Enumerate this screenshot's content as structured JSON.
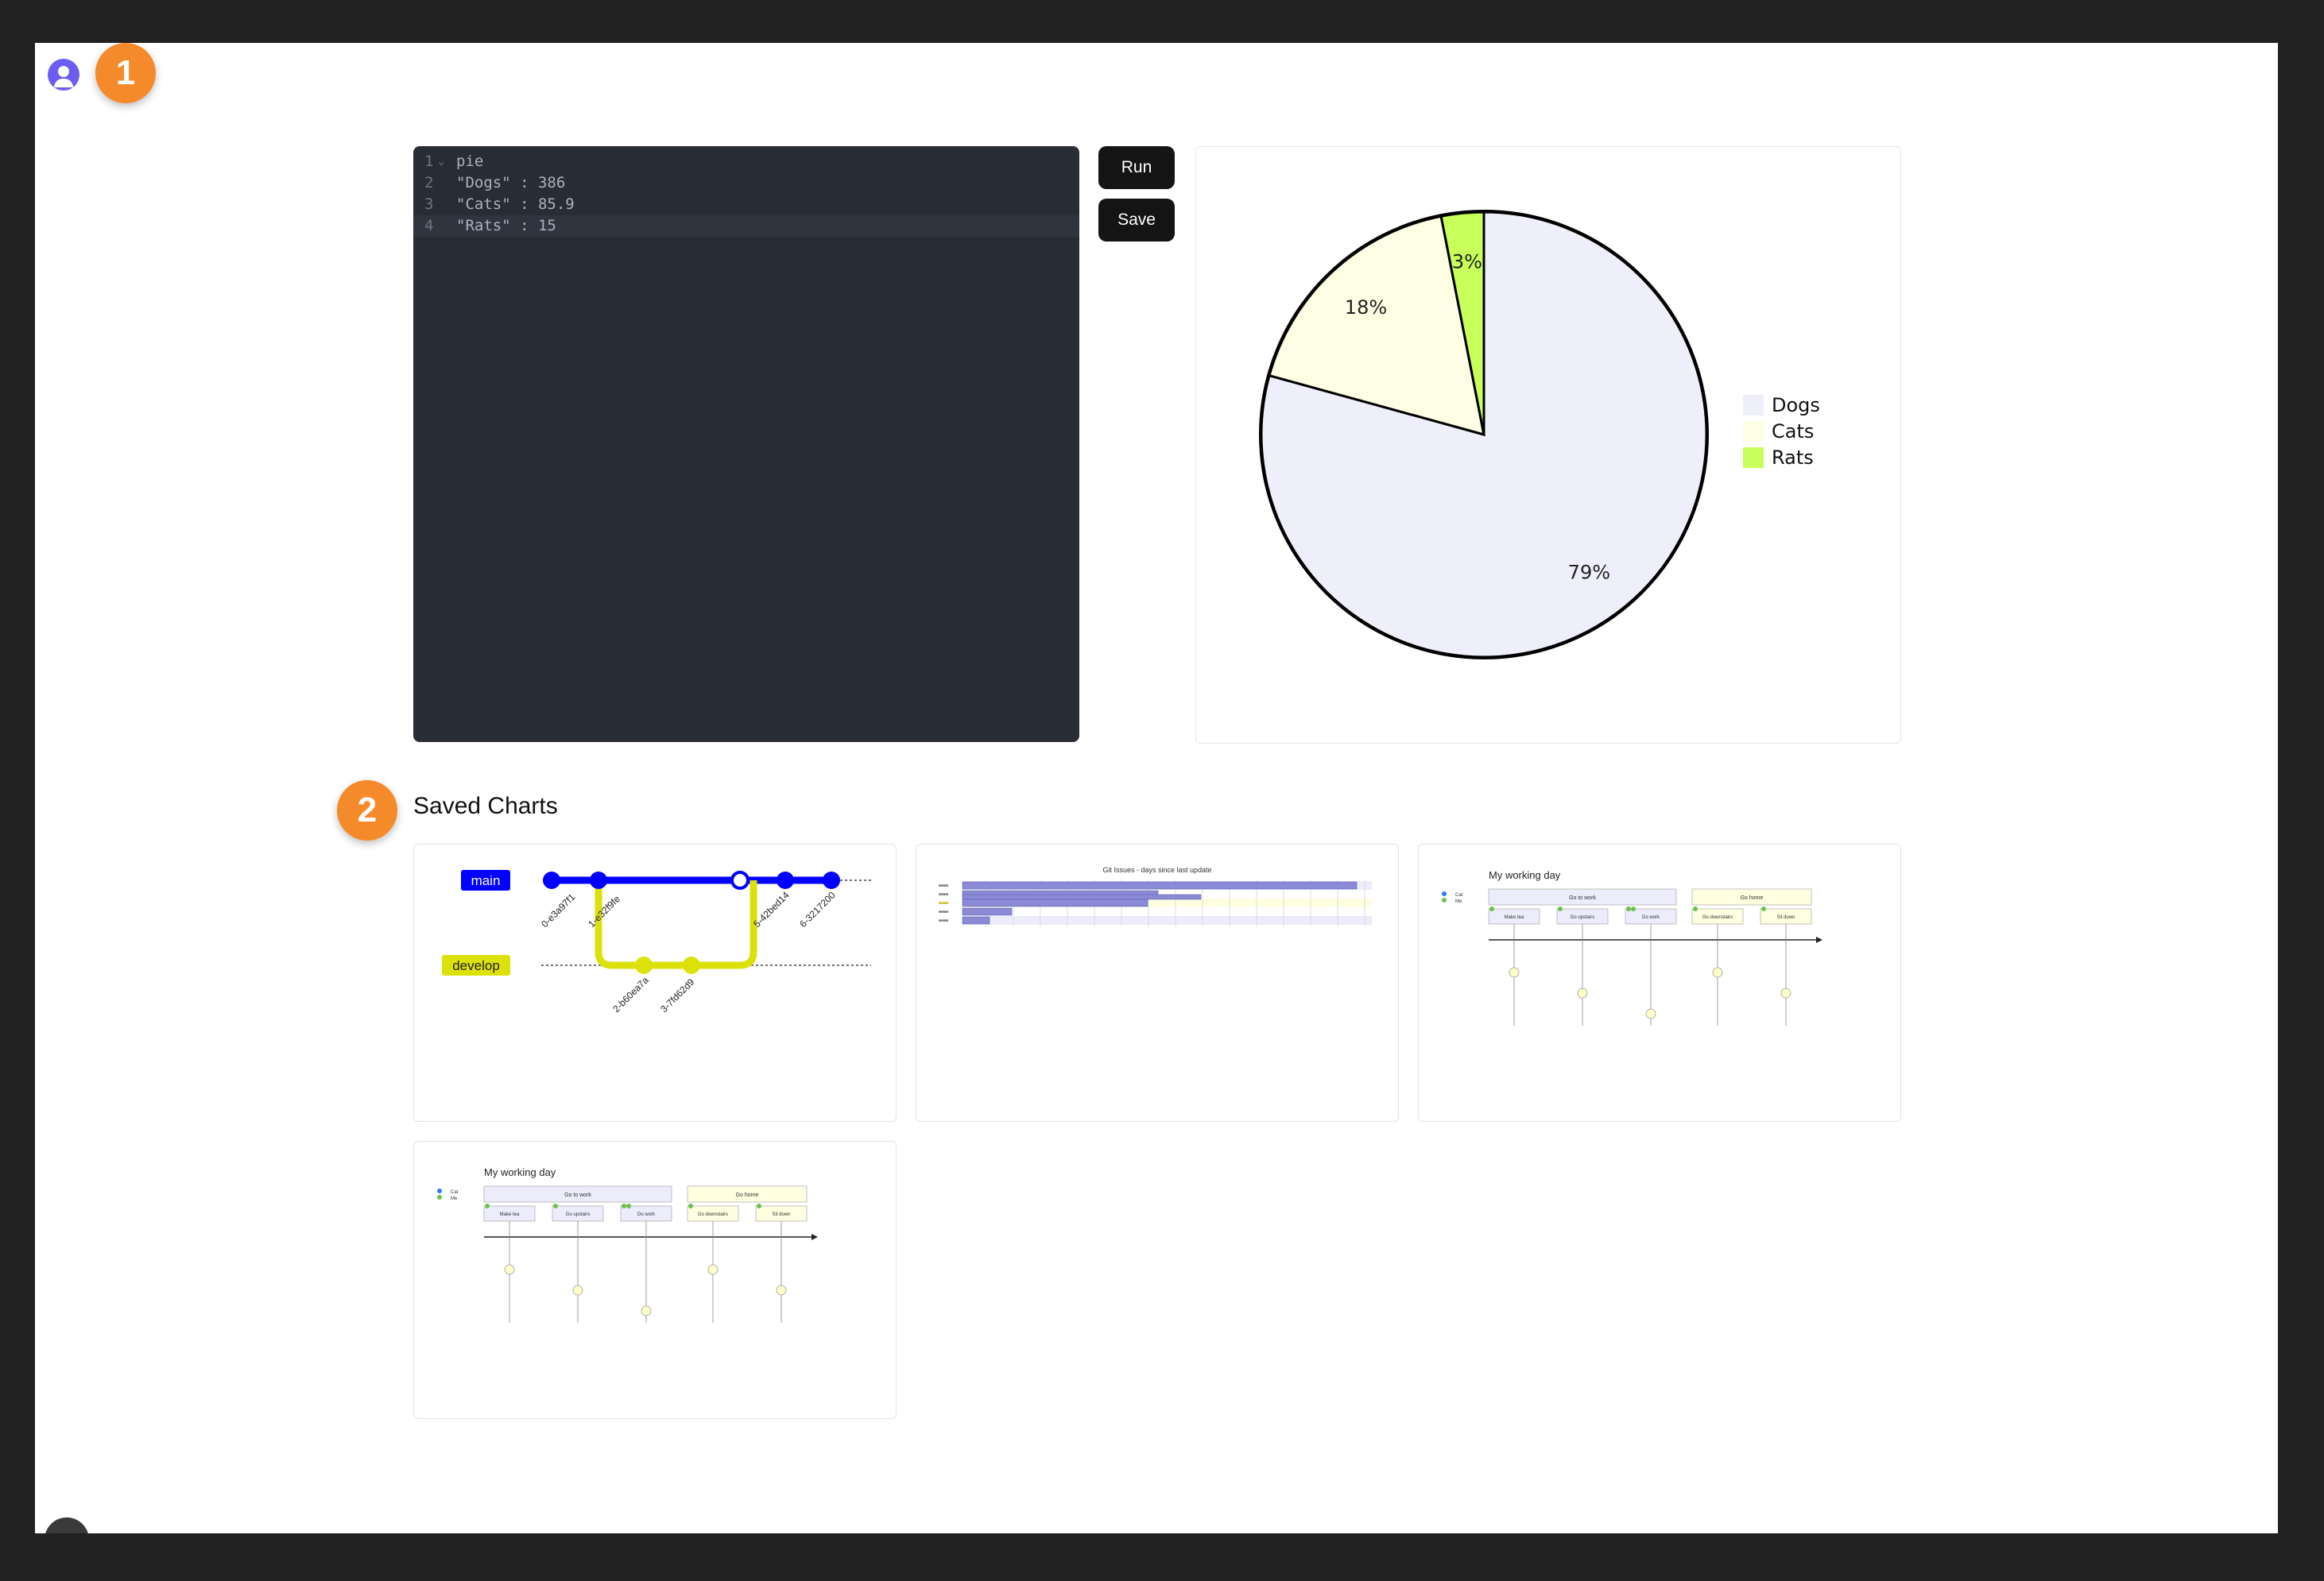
{
  "editor": {
    "lines": [
      {
        "num": "1",
        "text": "pie"
      },
      {
        "num": "2",
        "text": "\"Dogs\" : 386"
      },
      {
        "num": "3",
        "text": "\"Cats\" : 85.9"
      },
      {
        "num": "4",
        "text": "\"Rats\" : 15"
      }
    ]
  },
  "toolbar": {
    "run_label": "Run",
    "save_label": "Save"
  },
  "steps": {
    "one": "1",
    "two": "2"
  },
  "saved": {
    "title": "Saved Charts"
  },
  "chart_data": {
    "type": "pie",
    "slices": [
      {
        "label": "Dogs",
        "value": 386,
        "percent": "79%",
        "color": "#efeffb"
      },
      {
        "label": "Cats",
        "value": 85.9,
        "percent": "18%",
        "color": "#fefee5"
      },
      {
        "label": "Rats",
        "value": 15,
        "percent": "3%",
        "color": "#c8ff5a"
      }
    ],
    "legend_position": "right"
  },
  "thumbnails": {
    "git": {
      "branches": [
        "main",
        "develop"
      ],
      "commits": [
        "0-e3a97f1",
        "1-e32f9fe",
        "2-b60ea7a",
        "3-7fd62d9",
        "5-42bed14",
        "6-3217200"
      ]
    },
    "gantt": {
      "title": "Git Issues - days since last update"
    },
    "journey1": {
      "title": "My working day",
      "actors": [
        "Cat",
        "Me"
      ],
      "sections": [
        "Go to work",
        "Go home"
      ],
      "tasks": [
        "Make tea",
        "Go upstairs",
        "Do work",
        "Go downstairs",
        "Sit down"
      ]
    },
    "journey2": {
      "title": "My working day",
      "actors": [
        "Cat",
        "Me"
      ],
      "sections": [
        "Go to work",
        "Go home"
      ],
      "tasks": [
        "Make tea",
        "Go upstairs",
        "Do work",
        "Go downstairs",
        "Sit down"
      ]
    }
  },
  "colors": {
    "git_main": "#0000ff",
    "git_develop": "#dde10a",
    "gantt_bar": "#8a8ad6",
    "journey_section1": "#ececfb",
    "journey_section2": "#fefee0"
  }
}
